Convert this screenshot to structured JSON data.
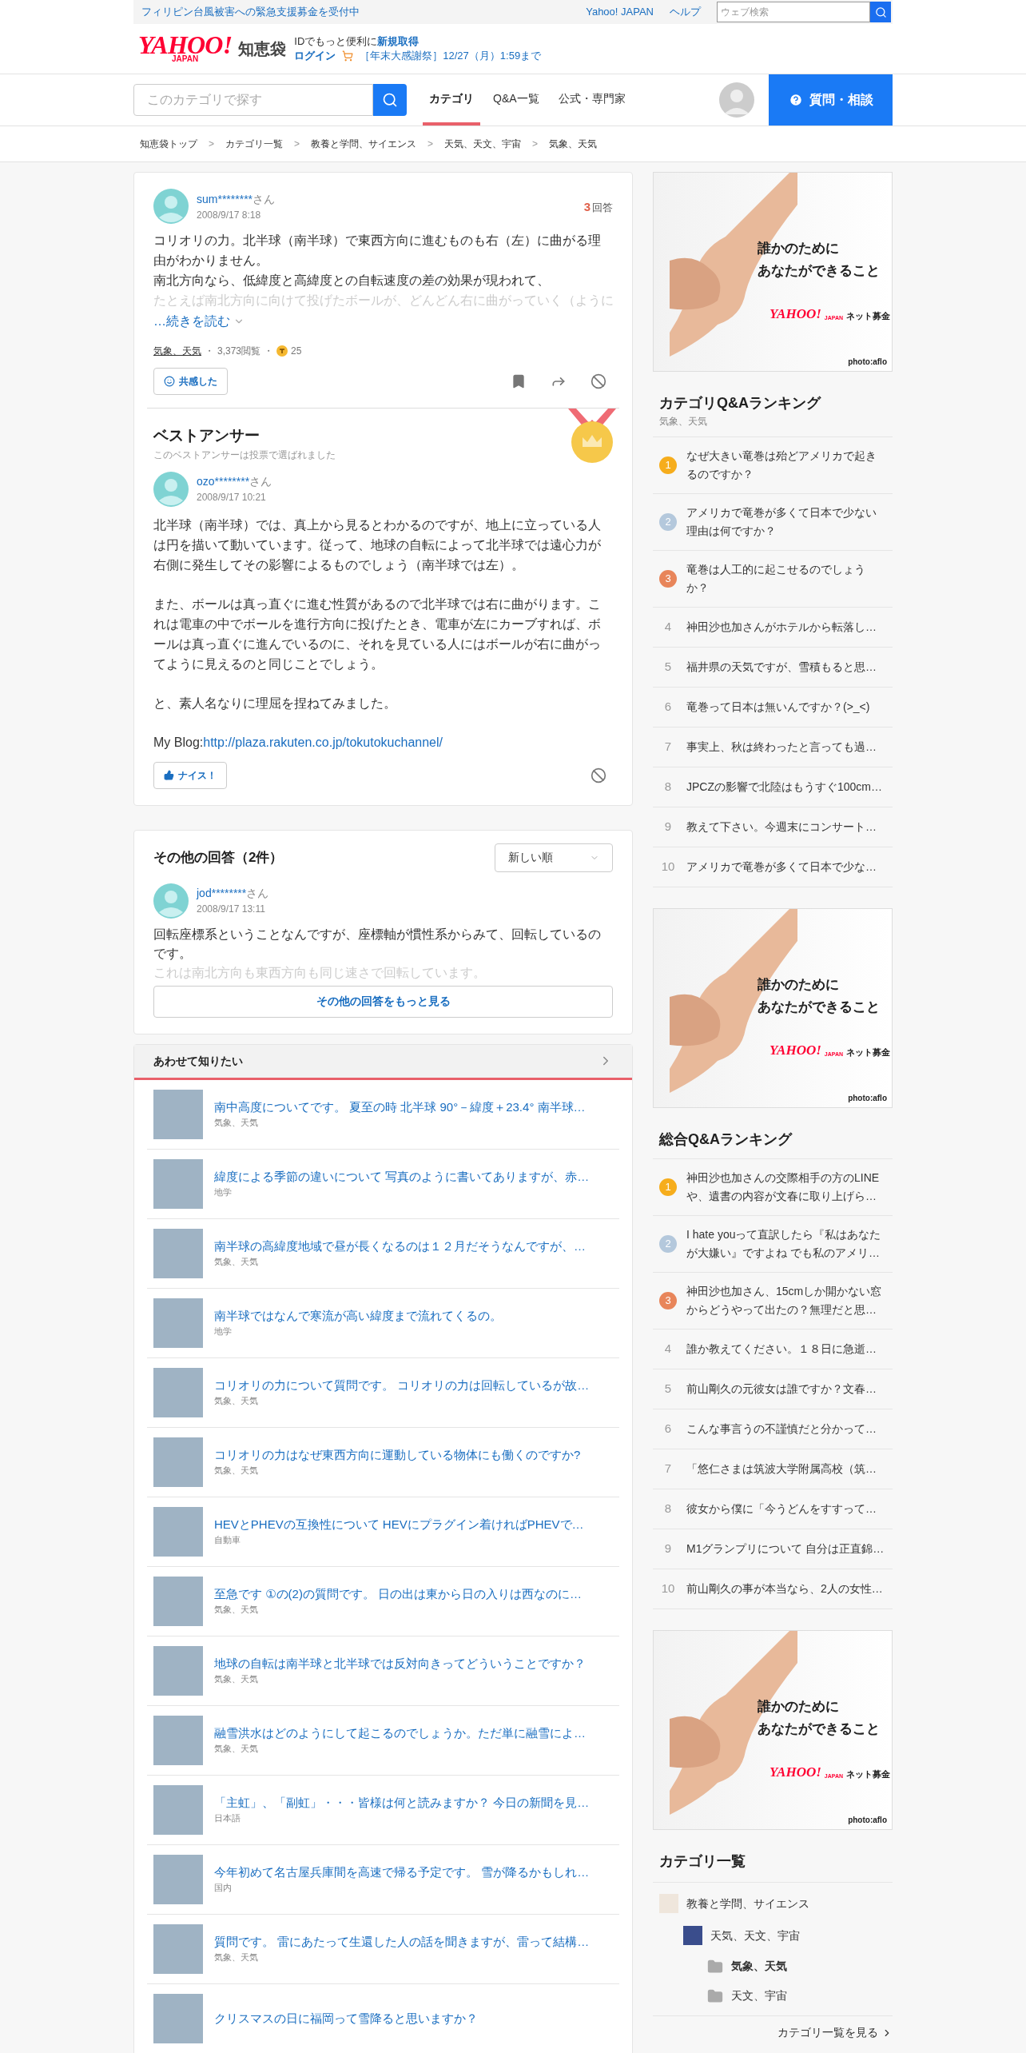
{
  "top_bar": {
    "notice": "フィリピン台風被害への緊急支援募金を受付中",
    "links": [
      "Yahoo! JAPAN",
      "ヘルプ"
    ],
    "search_placeholder": "ウェブ検索"
  },
  "header": {
    "logo": {
      "wordmark": "YAHOO!",
      "sub": "JAPAN",
      "service": "知恵袋"
    },
    "promo_text": "IDでもっと便利に",
    "promo_link": "新規取得",
    "login": "ログイン",
    "campaign": "［年末大感謝祭］12/27（月）1:59まで"
  },
  "nav": {
    "search_placeholder": "このカテゴリで探す",
    "tabs": [
      {
        "label": "カテゴリ",
        "selected": true
      },
      {
        "label": "Q&A一覧",
        "selected": false
      },
      {
        "label": "公式・専門家",
        "selected": false
      }
    ],
    "ask_button": "質問・相談"
  },
  "breadcrumb": {
    "separator": ">",
    "items": [
      "知恵袋トップ",
      "カテゴリ一覧",
      "教養と学問、サイエンス",
      "天気、天文、宇宙",
      "気象、天気"
    ]
  },
  "question": {
    "user": "sum********",
    "honorific": "さん",
    "date": "2008/9/17 8:18",
    "answer_count": "3",
    "answer_label": "回答",
    "lines": [
      "コリオリの力。北半球（南半球）で東西方向に進むものも右（左）に曲がる理由がわかりません。",
      "南北方向なら、低緯度と高緯度との自転速度の差の効果が現われて、"
    ],
    "faded_line": "たとえば南北方向に向けて投げたボールが、どんどん右に曲がっていく（ように",
    "read_more": "…続きを読む",
    "category": "気象、天気",
    "views": "3,373閲覧",
    "separator": "・",
    "coins": "25",
    "reaction": "共感した"
  },
  "best_answer": {
    "title": "ベストアンサー",
    "note": "このベストアンサーは投票で選ばれました",
    "user": "ozo********",
    "honorific": "さん",
    "date": "2008/9/17 10:21",
    "paragraphs": [
      "北半球（南半球）では、真上から見るとわかるのですが、地上に立っている人は円を描いて動いています。従って、地球の自転によって北半球では遠心力が右側に発生してその影響によるものでしょう（南半球では左）。",
      "また、ボールは真っ直ぐに進む性質があるので北半球では右に曲がります。これは電車の中でボールを進行方向に投げたとき、電車が左にカーブすれば、ボールは真っ直ぐに進んでいるのに、それを見ている人にはボールが右に曲がってように見えるのと同じことでしょう。",
      "と、素人名なりに理屈を捏ねてみました。"
    ],
    "blog": {
      "label": "My Blog:",
      "url": "http://plaza.rakuten.co.jp/tokutokuchannel/"
    },
    "nice": "ナイス！"
  },
  "other_answers": {
    "title": "その他の回答（2件）",
    "sort": "新しい順",
    "answers": [
      {
        "user": "jod********",
        "honorific": "さん",
        "date": "2008/9/17 13:11",
        "text": "回転座標系ということなんですが、座標軸が慣性系からみて、回転しているのです。",
        "faded": "これは南北方向も東西方向も同じ速さで回転しています。"
      }
    ],
    "more_button": "その他の回答をもっと見る"
  },
  "related": {
    "title": "あわせて知りたい",
    "items": [
      {
        "title": "南中高度についてです。 夏至の時 北半球 90°－緯度＋23.4° 南半球…",
        "category": "気象、天気"
      },
      {
        "title": "緯度による季節の違いについて 写真のように書いてありますが、赤…",
        "category": "地学"
      },
      {
        "title": "南半球の高緯度地域で昼が長くなるのは１２月だそうなんですが、…",
        "category": "気象、天気"
      },
      {
        "title": "南半球ではなんで寒流が高い緯度まで流れてくるの。",
        "category": "地学"
      },
      {
        "title": "コリオリの力について質問です。 コリオリの力は回転しているが故…",
        "category": "気象、天気"
      },
      {
        "title": "コリオリの力はなぜ東西方向に運動している物体にも働くのですか?",
        "category": "気象、天気"
      },
      {
        "title": "HEVとPHEVの互換性について HEVにプラグイン着ければPHEVで…",
        "category": "自動車"
      },
      {
        "title": "至急です ①の(2)の質問です。 日の出は東から日の入りは西なのに…",
        "category": "気象、天気"
      },
      {
        "title": "地球の自転は南半球と北半球では反対向きってどういうことですか？",
        "category": "気象、天気"
      },
      {
        "title": "融雪洪水はどのようにして起こるのでしょうか。ただ単に融雪によ…",
        "category": "気象、天気"
      },
      {
        "title": "「主虹」、「副虹」・・・皆様は何と読みますか？ 今日の新聞を見…",
        "category": "日本語"
      },
      {
        "title": "今年初めて名古屋兵庫間を高速で帰る予定です。 雪が降るかもしれ…",
        "category": "国内"
      },
      {
        "title": "質問です。 雷にあたって生還した人の話を聞きますが、雷って結構…",
        "category": "気象、天気"
      },
      {
        "title": "クリスマスの日に福岡って雪降ると思いますか？"
      }
    ]
  },
  "sidebar": [
    {
      "kind": "ad",
      "headline": [
        "誰かのために",
        "あなたができること"
      ],
      "brand": "YAHOO!",
      "brand_sub": "JAPAN",
      "service": "ネット募金",
      "credit": "photo:aflo"
    },
    {
      "kind": "ranking",
      "title": "カテゴリQ&Aランキング",
      "subtitle": "気象、天気",
      "items": [
        {
          "kind": "medal",
          "rank": "1",
          "color": "#f6ad1c",
          "text": "なぜ大きい竜巻は殆どアメリカで起きるのですか？"
        },
        {
          "kind": "medal",
          "rank": "2",
          "color": "#b4c8dc",
          "text": "アメリカで竜巻が多くて日本で少ない理由は何ですか？"
        },
        {
          "kind": "medal",
          "rank": "3",
          "color": "#e8855a",
          "text": "竜巻は人工的に起こせるのでしょうか？"
        },
        {
          "kind": "plain",
          "rank": "4",
          "text": "神田沙也加さんがホテルから転落し…"
        },
        {
          "kind": "plain",
          "rank": "5",
          "text": "福井県の天気ですが、雪積もると思…"
        },
        {
          "kind": "plain",
          "rank": "6",
          "text": "竜巻って日本は無いんですか？(>_<)"
        },
        {
          "kind": "plain",
          "rank": "7",
          "text": "事実上、秋は終わったと言っても過…"
        },
        {
          "kind": "plain",
          "rank": "8",
          "text": "JPCZの影響で北陸はもうすぐ100cm…"
        },
        {
          "kind": "plain",
          "rank": "9",
          "text": "教えて下さい。今週末にコンサート…"
        },
        {
          "kind": "plain",
          "rank": "10",
          "text": "アメリカで竜巻が多くて日本で少な…"
        }
      ]
    },
    {
      "kind": "ad",
      "headline": [
        "誰かのために",
        "あなたができること"
      ],
      "brand": "YAHOO!",
      "brand_sub": "JAPAN",
      "service": "ネット募金",
      "credit": "photo:aflo"
    },
    {
      "kind": "ranking",
      "title": "総合Q&Aランキング",
      "items": [
        {
          "kind": "medal",
          "rank": "1",
          "color": "#f6ad1c",
          "text": "神田沙也加さんの交際相手の方のLINEや、遺書の内容が文春に取り上げら…"
        },
        {
          "kind": "medal",
          "rank": "2",
          "color": "#b4c8dc",
          "text": "I hate youって直訳したら『私はあなたが大嫌い』ですよね でも私のアメリ…"
        },
        {
          "kind": "medal",
          "rank": "3",
          "color": "#e8855a",
          "text": "神田沙也加さん、15cmしか開かない窓からどうやって出たの？無理だと思…"
        },
        {
          "kind": "plain",
          "rank": "4",
          "text": "誰か教えてください。１８日に急逝…"
        },
        {
          "kind": "plain",
          "rank": "5",
          "text": "前山剛久の元彼女は誰ですか？文春…"
        },
        {
          "kind": "plain",
          "rank": "6",
          "text": "こんな事言うの不謹慎だと分かって…"
        },
        {
          "kind": "plain",
          "rank": "7",
          "text": "「悠仁さまは筑波大学附属高校（筑…"
        },
        {
          "kind": "plain",
          "rank": "8",
          "text": "彼女から僕に「今うどんをすすって…"
        },
        {
          "kind": "plain",
          "rank": "9",
          "text": "M1グランプリについて 自分は正直錦…"
        },
        {
          "kind": "plain",
          "rank": "10",
          "text": "前山剛久の事が本当なら、2人の女性…"
        }
      ]
    },
    {
      "kind": "ad",
      "headline": [
        "誰かのために",
        "あなたができること"
      ],
      "brand": "YAHOO!",
      "brand_sub": "JAPAN",
      "service": "ネット募金",
      "credit": "photo:aflo"
    },
    {
      "kind": "categories",
      "title": "カテゴリ一覧",
      "tree": [
        {
          "label": "教養と学問、サイエンス",
          "selected": false,
          "children": [
            {
              "label": "天気、天文、宇宙",
              "selected": false,
              "children": [
                {
                  "label": "気象、天気",
                  "selected": true
                },
                {
                  "label": "天文、宇宙",
                  "selected": false
                }
              ]
            }
          ]
        }
      ],
      "more": "カテゴリ一覧を見る"
    },
    {
      "kind": "card"
    }
  ]
}
